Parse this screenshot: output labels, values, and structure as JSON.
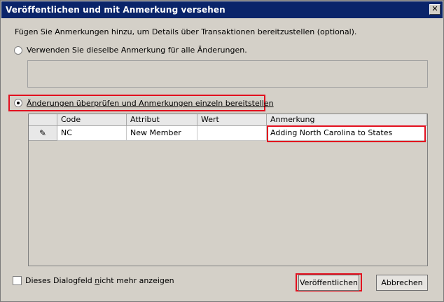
{
  "window": {
    "title": "Veröffentlichen und mit Anmerkung versehen",
    "close_glyph": "✕"
  },
  "intro_text": "Fügen Sie Anmerkungen hinzu, um Details über Transaktionen bereitzustellen (optional).",
  "option_same": {
    "label": "Verwenden Sie dieselbe Anmerkung für alle Änderungen.",
    "selected": false,
    "annotation_value": ""
  },
  "option_individual": {
    "label": "Änderungen überprüfen und Anmerkungen einzeln bereitstellen",
    "selected": true
  },
  "grid": {
    "columns": [
      "Code",
      "Attribut",
      "Wert",
      "Anmerkung"
    ],
    "rows": [
      {
        "row_icon": "✎",
        "Code": "NC",
        "Attribut": "New Member",
        "Wert": "",
        "Anmerkung": "Adding North Carolina to States"
      }
    ]
  },
  "dont_show": {
    "label_prefix": "Dieses Dialogfeld ",
    "label_underlined": "n",
    "label_suffix": "icht mehr anzeigen",
    "checked": false
  },
  "buttons": {
    "publish": "Veröffentlichen",
    "cancel": "Abbrechen"
  },
  "colors": {
    "highlight": "#e2101f",
    "titlebar": "#0a246a",
    "dialog_bg": "#d4d0c8"
  }
}
